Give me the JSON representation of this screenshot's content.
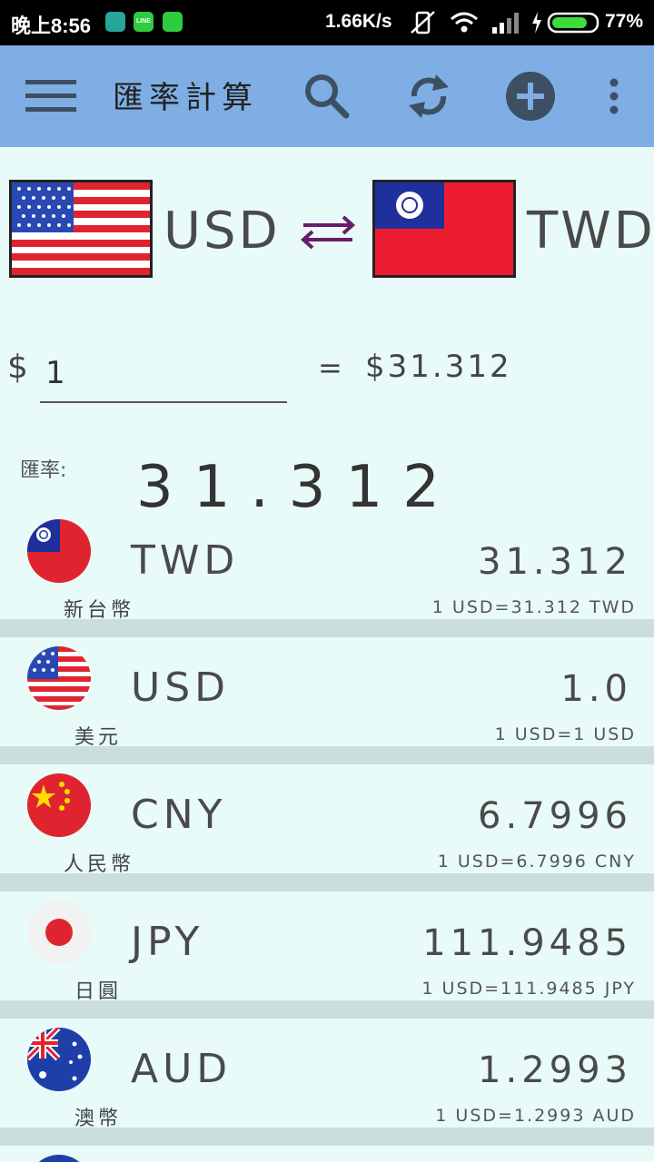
{
  "status_bar": {
    "time": "晚上8:56",
    "speed": "1.66K/s",
    "battery": "77%"
  },
  "app_bar": {
    "title": "匯率計算",
    "icons": [
      "menu-icon",
      "search-icon",
      "refresh-icon",
      "add-icon",
      "more-icon"
    ]
  },
  "pair": {
    "from_code": "USD",
    "to_code": "TWD"
  },
  "converter": {
    "dollar_sign": "$",
    "amount": "1",
    "equals": "=",
    "result": "$31.312"
  },
  "rate": {
    "label": "匯率:",
    "value": "31.312"
  },
  "currencies": [
    {
      "code": "TWD",
      "name": "新台幣",
      "value": "31.312",
      "conversion": "1 USD=31.312 TWD"
    },
    {
      "code": "USD",
      "name": "美元",
      "value": "1.0",
      "conversion": "1 USD=1 USD"
    },
    {
      "code": "CNY",
      "name": "人民幣",
      "value": "6.7996",
      "conversion": "1 USD=6.7996 CNY"
    },
    {
      "code": "JPY",
      "name": "日圓",
      "value": "111.9485",
      "conversion": "1 USD=111.9485 JPY"
    },
    {
      "code": "AUD",
      "name": "澳幣",
      "value": "1.2993",
      "conversion": "1 USD=1.2993 AUD"
    }
  ],
  "colors": {
    "app_bar": "#7eaee3",
    "background": "#e8fbf9",
    "separator": "#c9dedd",
    "swap_arrow": "#6a1b6a"
  }
}
